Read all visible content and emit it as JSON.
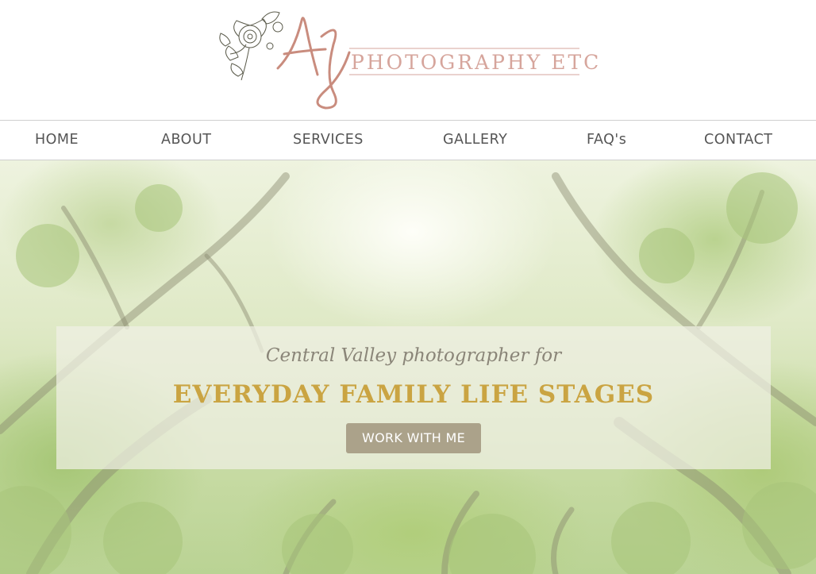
{
  "logo": {
    "monogram": "AJ",
    "text": "PHOTOGRAPHY ETC",
    "icon": "floral-icon"
  },
  "nav": {
    "items": [
      {
        "label": "HOME"
      },
      {
        "label": "ABOUT"
      },
      {
        "label": "SERVICES"
      },
      {
        "label": "GALLERY"
      },
      {
        "label": "FAQ's"
      },
      {
        "label": "CONTACT"
      }
    ]
  },
  "hero": {
    "tagline": "Central Valley photographer for",
    "headline": "EVERYDAY FAMILY LIFE STAGES",
    "cta_label": "WORK WITH ME"
  },
  "colors": {
    "logo_pink": "#c98c7e",
    "headline_gold": "#caa442",
    "button_taupe": "#aba28a",
    "nav_text": "#555555"
  }
}
